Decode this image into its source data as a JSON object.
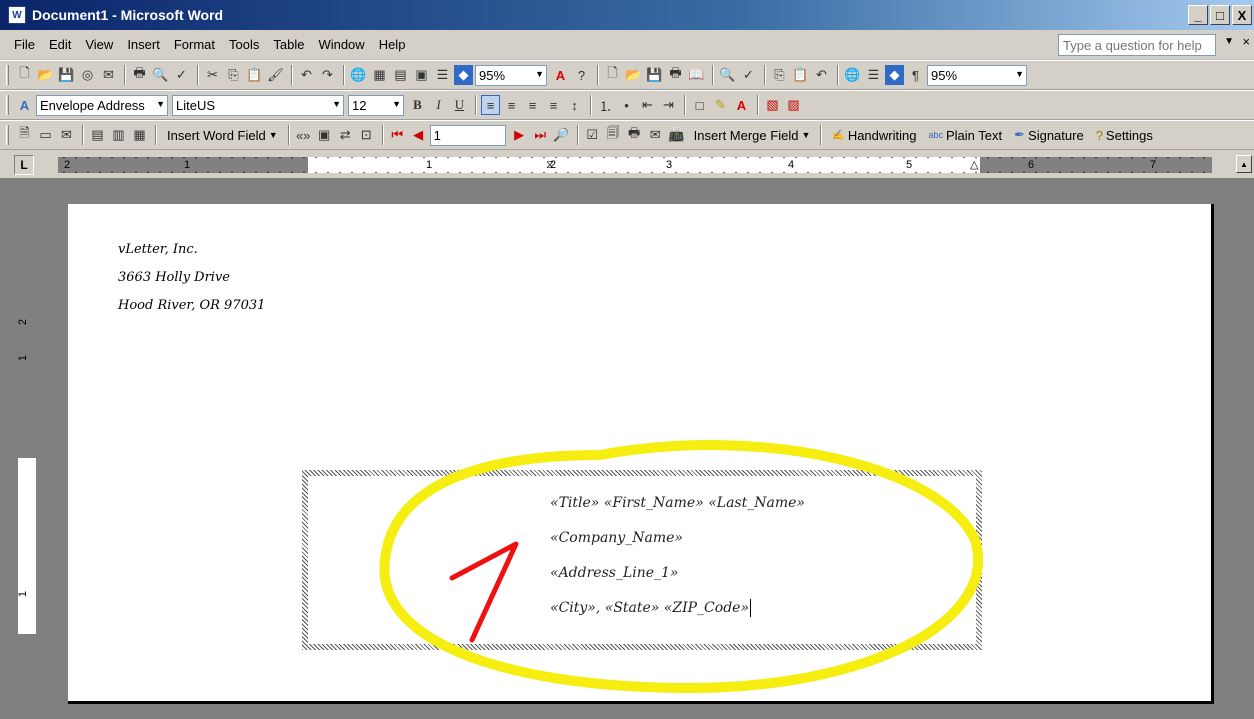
{
  "window": {
    "title": "Document1 - Microsoft Word",
    "app_icon": "W",
    "min": "_",
    "max": "□",
    "close": "X"
  },
  "menu": [
    "File",
    "Edit",
    "View",
    "Insert",
    "Format",
    "Tools",
    "Table",
    "Window",
    "Help"
  ],
  "help": {
    "placeholder": "Type a question for help",
    "close": "×"
  },
  "toolbar1": {
    "zoom_left": "95%",
    "zoom_right": "95%",
    "pilcrow": "¶"
  },
  "toolbar2": {
    "style": "Envelope Address",
    "font": "LiteUS",
    "size": "12",
    "bold": "B",
    "italic": "I",
    "underline": "U"
  },
  "toolbar3": {
    "insert_word_field": "Insert Word Field",
    "record": "1",
    "insert_merge_field": "Insert Merge Field",
    "handwriting": "Handwriting",
    "plain_text": "Plain Text",
    "signature": "Signature",
    "settings": "Settings"
  },
  "ruler": {
    "tab_selector": "L",
    "marks": [
      "2",
      "1",
      "1",
      "2",
      "3",
      "4",
      "5",
      "6",
      "7"
    ],
    "vmarks": [
      "2",
      "1",
      "1"
    ]
  },
  "document": {
    "return_address": [
      "vLetter, Inc.",
      "3663 Holly Drive",
      "Hood River, OR 97031"
    ],
    "delivery_address": [
      "«Title» «First_Name» «Last_Name»",
      "«Company_Name»",
      "«Address_Line_1»",
      "«City», «State» «ZIP_Code»"
    ]
  },
  "colors": {
    "titlebar": "#0a246a",
    "annotation_circle": "#f5ee10",
    "annotation_mark": "#ee1111"
  }
}
